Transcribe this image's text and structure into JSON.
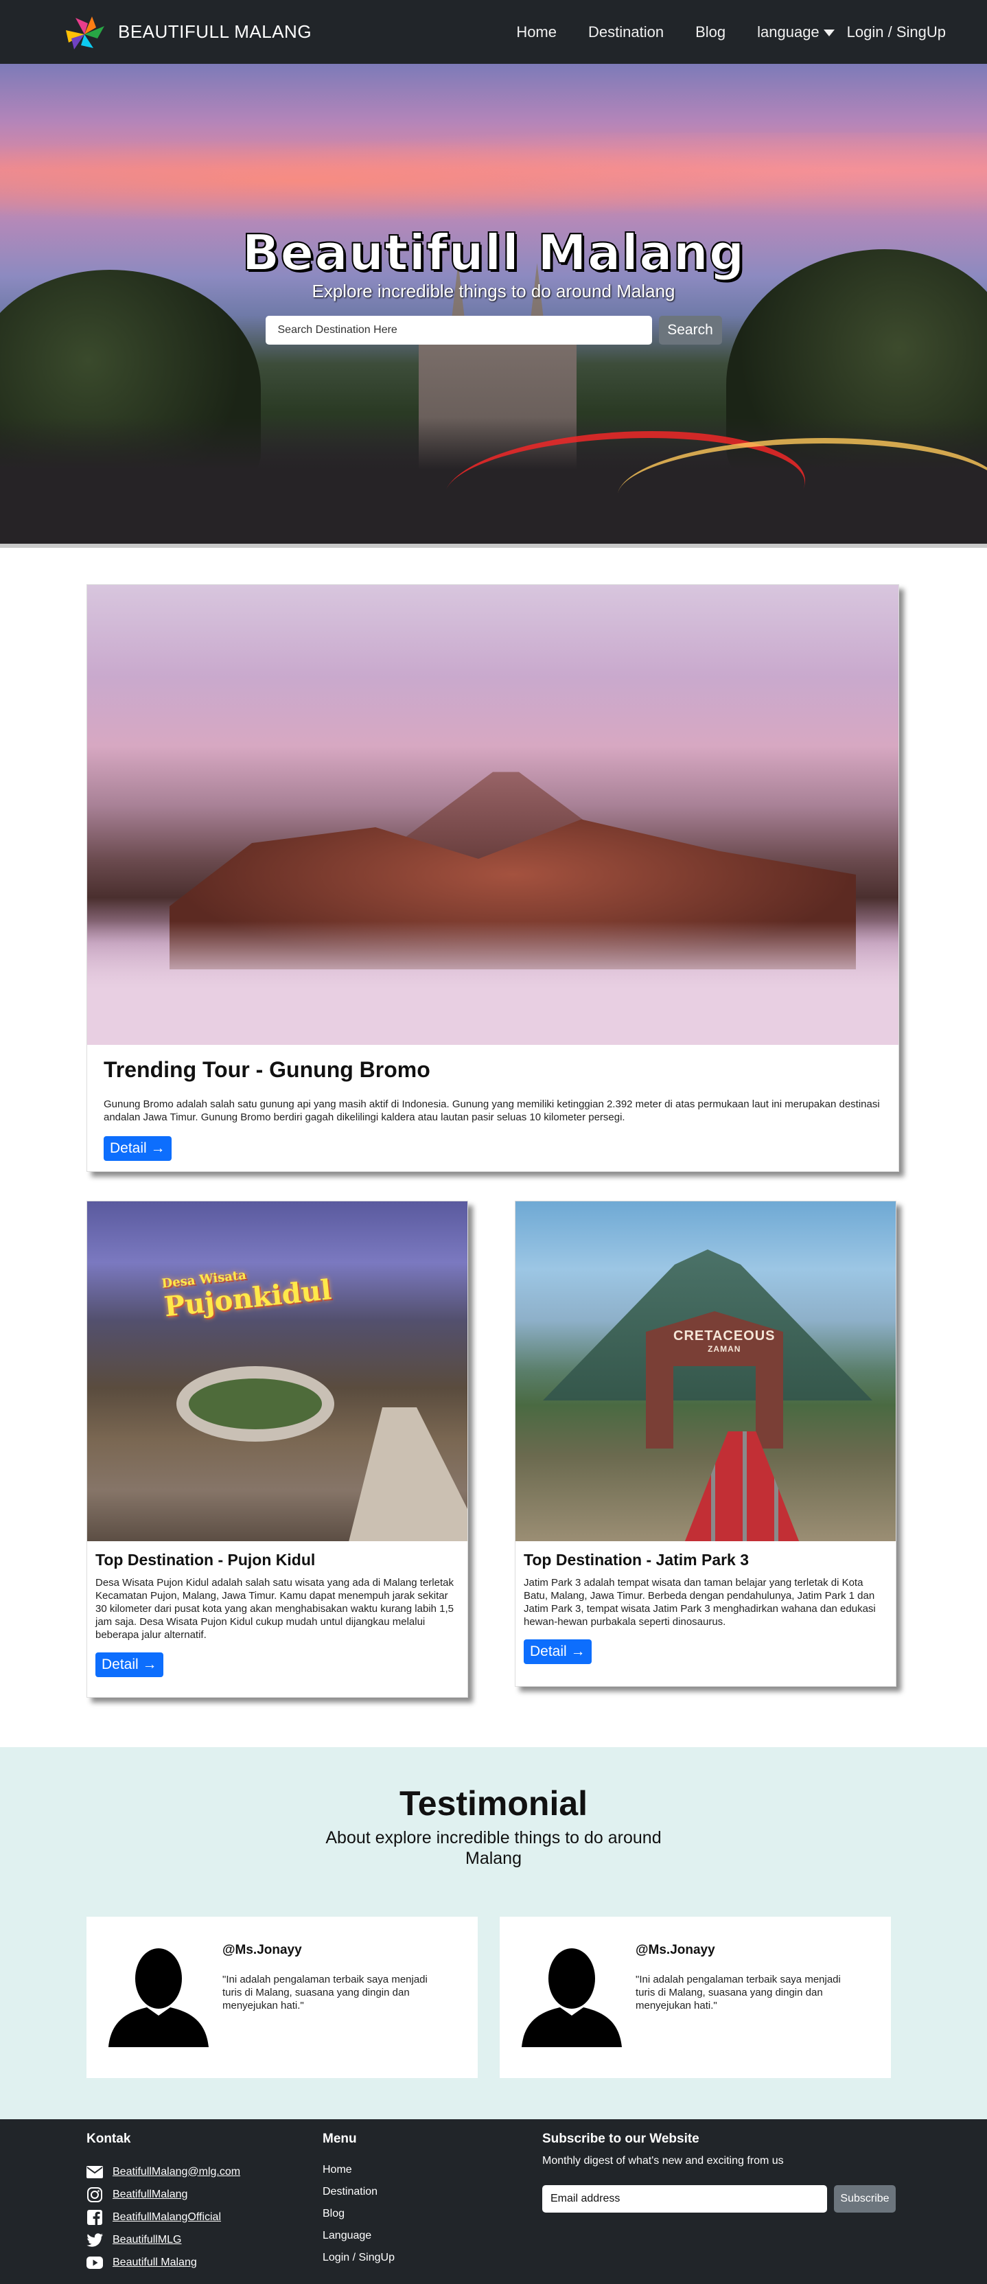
{
  "navbar": {
    "brand": "BEAUTIFULL MALANG",
    "links": [
      "Home",
      "Destination",
      "Blog"
    ],
    "language": "language",
    "login": "Login / SingUp"
  },
  "hero": {
    "title": "Beautifull Malang",
    "subtitle": "Explore incredible things to do around Malang",
    "search_placeholder": "Search Destination Here",
    "search_button": "Search"
  },
  "trending": {
    "title": "Trending Tour - Gunung Bromo",
    "text": "Gunung Bromo adalah salah satu gunung api yang masih aktif di Indonesia. Gunung yang memiliki ketinggian 2.392 meter di atas permukaan laut ini merupakan destinasi andalan Jawa Timur. Gunung Bromo berdiri gagah dikelilingi kaldera atau lautan pasir seluas 10 kilometer persegi.",
    "button": "Detail →"
  },
  "destinations": [
    {
      "title": "Top Destination - Pujon Kidul",
      "text": "Desa Wisata Pujon Kidul adalah salah satu wisata yang ada di Malang terletak Kecamatan Pujon, Malang, Jawa Timur. Kamu dapat menempuh jarak sekitar 30 kilometer dari pusat kota yang akan menghabisakan waktu kurang labih 1,5 jam saja. Desa Wisata Pujon Kidul cukup mudah untul dijangkau melalui beberapa jalur alternatif.",
      "button": "Detail →",
      "image_sign": "Pujonkidul",
      "image_sign_small": "Desa Wisata"
    },
    {
      "title": "Top Destination - Jatim Park 3",
      "text": "Jatim Park 3 adalah tempat wisata dan taman belajar yang terletak di Kota Batu, Malang, Jawa Timur. Berbeda dengan pendahulunya, Jatim Park 1 dan Jatim Park 3, tempat wisata Jatim Park 3 menghadirkan wahana dan edukasi hewan-hewan purbakala seperti dinosaurus.",
      "button": "Detail →",
      "image_sign": "CRETACEOUS",
      "image_sign_small": "ZAMAN"
    }
  ],
  "testimonial": {
    "title": "Testimonial",
    "subtitle": "About explore incredible things to do around Malang",
    "items": [
      {
        "name": "@Ms.Jonayy",
        "quote": "\"Ini adalah pengalaman terbaik saya menjadi turis di Malang, suasana yang dingin dan menyejukan hati.\""
      },
      {
        "name": "@Ms.Jonayy",
        "quote": "\"Ini adalah pengalaman terbaik saya menjadi turis di Malang, suasana yang dingin dan menyejukan hati.\""
      }
    ]
  },
  "footer": {
    "contact_heading": "Kontak",
    "contacts": [
      {
        "icon": "envelope-icon",
        "label": "BeatifullMalang@mlg.com"
      },
      {
        "icon": "instagram-icon",
        "label": "BeatifullMalang"
      },
      {
        "icon": "facebook-icon",
        "label": "BeatifullMalangOfficial"
      },
      {
        "icon": "twitter-icon",
        "label": "BeautifullMLG"
      },
      {
        "icon": "youtube-icon",
        "label": "Beautifull Malang"
      }
    ],
    "menu_heading": "Menu",
    "menu": [
      "Home",
      "Destination",
      "Blog",
      "Language",
      "Login / SingUp"
    ],
    "subscribe_heading": "Subscribe to our Website",
    "subscribe_desc": "Monthly digest of what's new and exciting from us",
    "email_placeholder": "Email address",
    "subscribe_button": "Subscribe"
  },
  "colors": {
    "dark": "#212529",
    "primary": "#0d6efd",
    "secondary": "#6c757d",
    "testimonial_bg": "#e0f1f0"
  }
}
